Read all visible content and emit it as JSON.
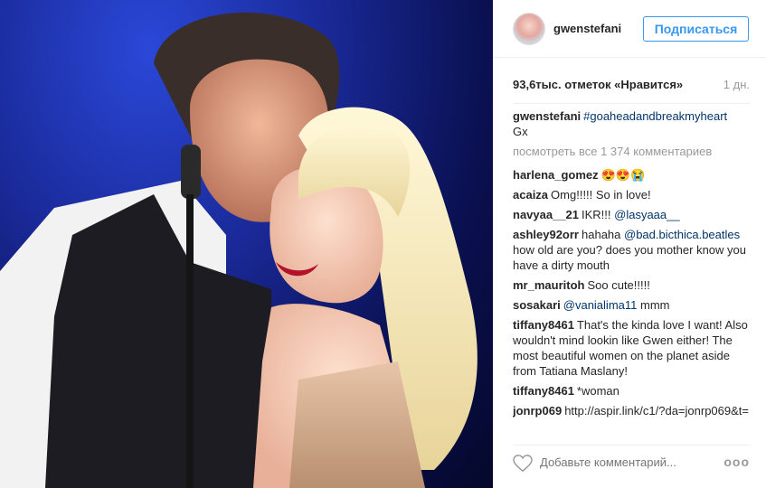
{
  "post": {
    "photo_icon": "photo-placeholder"
  },
  "header": {
    "username": "gwenstefani",
    "follow_label": "Подписаться"
  },
  "meta": {
    "likes": "93,6тыс. отметок «Нравится»",
    "time": "1 дн."
  },
  "caption": {
    "user": "gwenstefani",
    "hashtag": "#goaheadandbreakmyheart",
    "text": "Gx"
  },
  "view_all": "посмотреть все 1 374 комментариев",
  "comments": [
    {
      "user": "harlena_gomez",
      "text": "😍😍😭"
    },
    {
      "user": "acaiza",
      "text": "Omg!!!!! So in love!"
    },
    {
      "user": "navyaa__21",
      "text": "IKR!!! ",
      "tag": "@lasyaaa__"
    },
    {
      "user": "ashley92orr",
      "text": "hahaha ",
      "tag": "@bad.bicthica.beatles",
      "text2": " how old are you? does you mother know you have a dirty mouth"
    },
    {
      "user": "mr_mauritoh",
      "text": "Soo cute!!!!!"
    },
    {
      "user": "sosakari",
      "tag": "@vanialima11",
      "text2": " mmm"
    },
    {
      "user": "tiffany8461",
      "text": "That's the kinda love I want! Also wouldn't mind lookin like Gwen either! The most beautiful women on the planet aside from Tatiana Maslany!"
    },
    {
      "user": "tiffany8461",
      "text": "*woman"
    },
    {
      "user": "jonrp069",
      "text": "http://aspir.link/c1/?da=jonrp069&t="
    }
  ],
  "footer": {
    "comment_placeholder": "Добавьте комментарий...",
    "more_label": "ooo",
    "heart_icon": "heart-icon"
  }
}
